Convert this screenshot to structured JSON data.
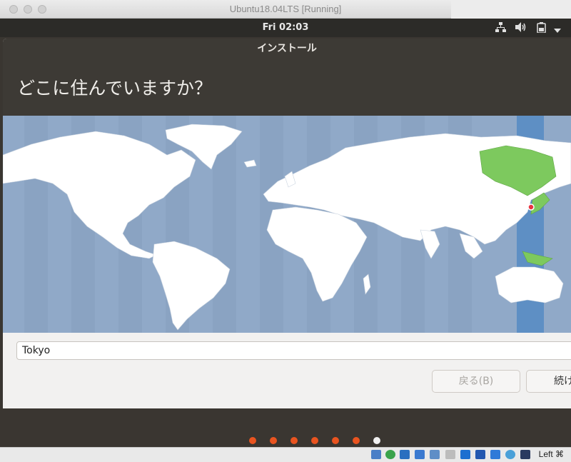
{
  "vm_window": {
    "title": "Ubuntu18.04LTS [Running]"
  },
  "top_bar": {
    "clock": "Fri 02:03",
    "icons": [
      "network-icon",
      "volume-icon",
      "battery-icon",
      "dropdown-arrow-icon"
    ]
  },
  "installer": {
    "window_title": "インストール",
    "question": "どこに住んでいますか？",
    "selected_zone_color": "#5e8fc4",
    "selected_region_color": "#7dc95e",
    "location_value": "Tokyo",
    "back_label": "戻る(B)",
    "continue_label": "続け"
  },
  "progress": {
    "total_steps": 7,
    "current_step": 7,
    "done_color": "#e95420",
    "current_color": "#f0f0f0"
  },
  "statusbar": {
    "host_key": "Left ⌘",
    "icons": [
      "storage-icon",
      "optical-drive-icon",
      "audio-icon",
      "network-adapter-icon",
      "usb-icon",
      "shared-folder-icon",
      "display-icon",
      "video-capture-icon",
      "cpu-icon",
      "mouse-integration-icon",
      "host-key-arrow-icon"
    ]
  }
}
